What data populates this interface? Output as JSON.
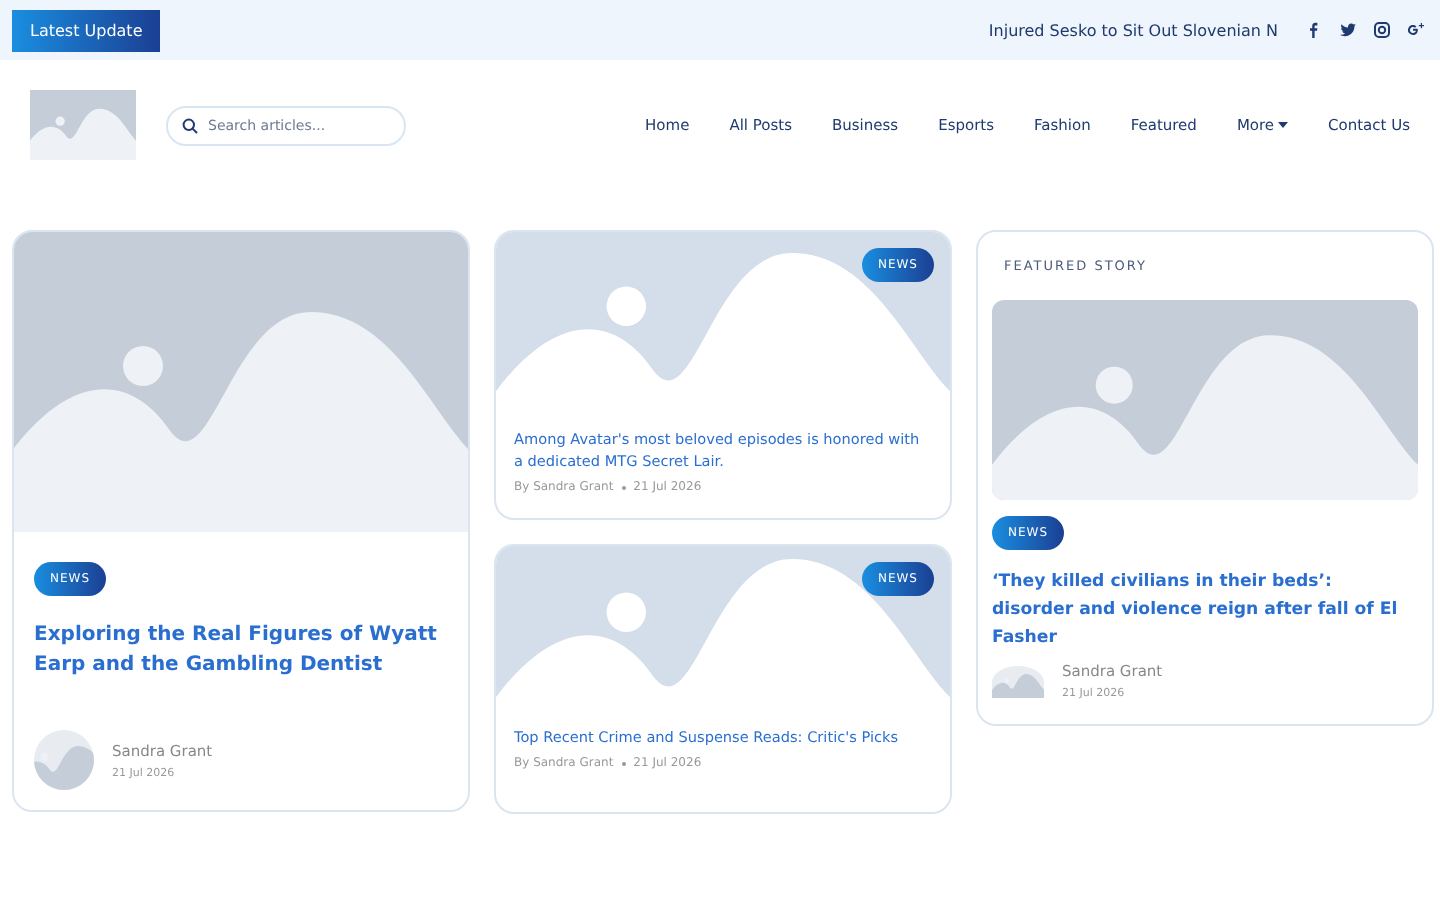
{
  "topbar": {
    "label": "Latest Update",
    "ticker": "Injured Sesko to Sit Out Slovenian N"
  },
  "header": {
    "search": {
      "placeholder": "Search articles..."
    },
    "nav": [
      {
        "label": "Home",
        "dropdown": false
      },
      {
        "label": "All Posts",
        "dropdown": false
      },
      {
        "label": "Business",
        "dropdown": false
      },
      {
        "label": "Esports",
        "dropdown": false
      },
      {
        "label": "Fashion",
        "dropdown": false
      },
      {
        "label": "Featured",
        "dropdown": false
      },
      {
        "label": "More",
        "dropdown": true
      },
      {
        "label": "Contact Us",
        "dropdown": false
      }
    ]
  },
  "main_story": {
    "tag": "NEWS",
    "title": "Exploring the Real Figures of Wyatt Earp and the Gambling Dentist",
    "author": "Sandra Grant",
    "date": "21 Jul 2026"
  },
  "side_stories": [
    {
      "tag": "NEWS",
      "title": "Among Avatar's most beloved episodes is honored with a dedicated MTG Secret Lair.",
      "author": "By Sandra Grant",
      "date": "21 Jul 2026"
    },
    {
      "tag": "NEWS",
      "title": "Top Recent Crime and Suspense Reads: Critic's Picks",
      "author": "By Sandra Grant",
      "date": "21 Jul 2026"
    }
  ],
  "featured": {
    "heading": "FEATURED STORY",
    "tag": "NEWS",
    "title": "‘They killed civilians in their beds’: disorder and violence reign after fall of El Fasher",
    "author": "Sandra Grant",
    "date": "21 Jul 2026"
  }
}
